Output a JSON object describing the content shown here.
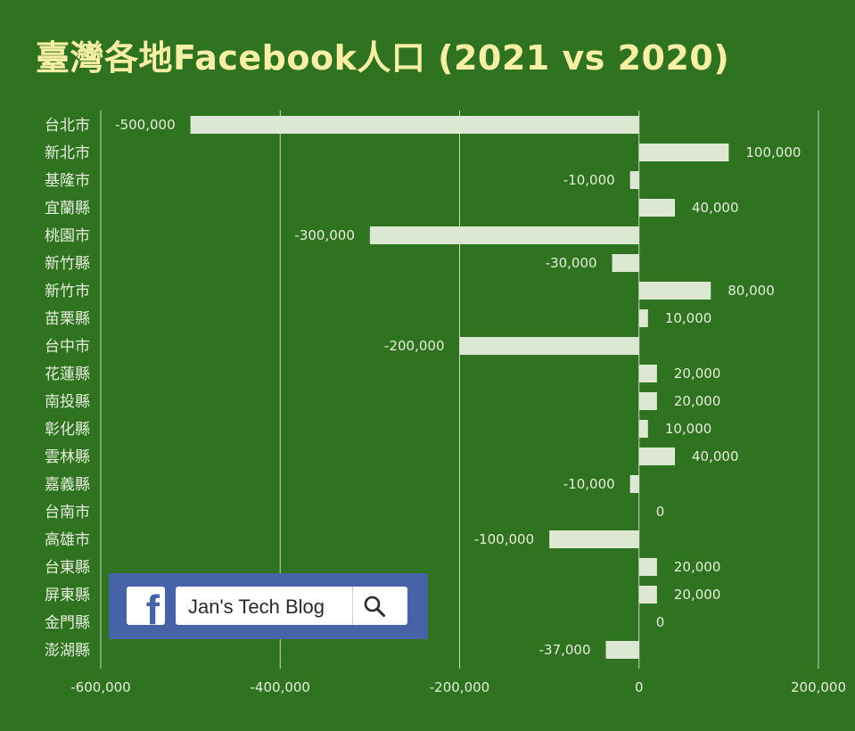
{
  "title": "臺灣各地Facebook人口 (2021 vs 2020)",
  "colors": {
    "background": "#2f7320",
    "bar": "#dde8d3",
    "gridline": "#c9d6c0",
    "title": "#f7efa6",
    "text": "#e6eddc",
    "badge": "#4763a8"
  },
  "badge": {
    "logo_icon": "facebook-f-icon",
    "search_text": "Jan's Tech Blog",
    "search_icon": "search-icon"
  },
  "chart_data": {
    "type": "bar",
    "orientation": "horizontal",
    "title": "臺灣各地Facebook人口 (2021 vs 2020)",
    "categories": [
      "台北市",
      "新北市",
      "基隆市",
      "宜蘭縣",
      "桃園市",
      "新竹縣",
      "新竹市",
      "苗栗縣",
      "台中市",
      "花蓮縣",
      "南投縣",
      "彰化縣",
      "雲林縣",
      "嘉義縣",
      "台南市",
      "高雄市",
      "台東縣",
      "屏東縣",
      "金門縣",
      "澎湖縣"
    ],
    "values": [
      -500000,
      100000,
      -10000,
      40000,
      -300000,
      -30000,
      80000,
      10000,
      -200000,
      20000,
      20000,
      10000,
      40000,
      -10000,
      0,
      -100000,
      20000,
      20000,
      0,
      -37000
    ],
    "value_labels": [
      "-500,000",
      "100,000",
      "-10,000",
      "40,000",
      "-300,000",
      "-30,000",
      "80,000",
      "10,000",
      "-200,000",
      "20,000",
      "20,000",
      "10,000",
      "40,000",
      "-10,000",
      "0",
      "-100,000",
      "20,000",
      "20,000",
      "0",
      "-37,000"
    ],
    "xlim": [
      -600000,
      200000
    ],
    "xticks": [
      -600000,
      -400000,
      -200000,
      0,
      200000
    ],
    "xtick_labels": [
      "-600,000",
      "-400,000",
      "-200,000",
      "0",
      "200,000"
    ],
    "grid": true,
    "legend": "none"
  }
}
